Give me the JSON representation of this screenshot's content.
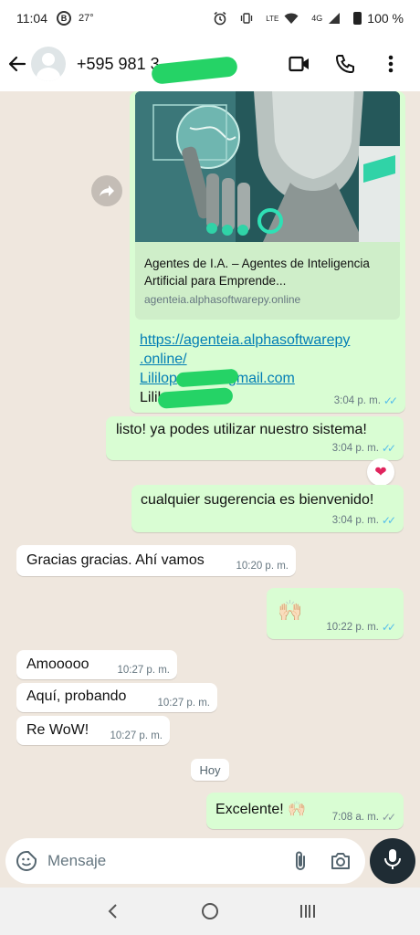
{
  "status_bar": {
    "time": "11:04",
    "temperature": "27°",
    "network": "4G",
    "lte": "LTE",
    "battery": "100 %"
  },
  "header": {
    "contact_name": "+595 981 3",
    "icons": [
      "arrow-left-icon",
      "video-call-icon",
      "phone-icon",
      "more-vert-icon"
    ]
  },
  "messages": [
    {
      "type": "link-preview",
      "preview_title": "Agentes de I.A. – Agentes de Inteligencia Artificial para Emprende...",
      "preview_domain": "agenteia.alphasoftwarepy.online",
      "link_line1": "https://agenteia.alphasoftwarepy",
      "link_line2": ".online/",
      "email": "Lililop",
      "email_suffix": "gmail.com",
      "name_line": "Lililop",
      "time": "3:04 p. m."
    },
    {
      "dir": "out",
      "text": "listo! ya podes utilizar nuestro sistema!",
      "time": "3:04 p. m."
    },
    {
      "dir": "out",
      "text": "cualquier sugerencia es bienvenido!",
      "time": "3:04 p. m."
    },
    {
      "dir": "in",
      "text": "Gracias gracias. Ahí vamos",
      "time": "10:20 p. m."
    },
    {
      "dir": "out",
      "text": "🙌🏻",
      "time": "10:22 p. m."
    },
    {
      "dir": "in",
      "text": "Amooooo",
      "time": "10:27 p. m."
    },
    {
      "dir": "in",
      "text": "Aquí, probando",
      "time": "10:27 p. m."
    },
    {
      "dir": "in",
      "text": "Re WoW!",
      "time": "10:27 p. m."
    },
    {
      "dir": "out",
      "text": "Excelente! 🙌🏻",
      "time": "7:08 a. m."
    }
  ],
  "day_chip": "Hoy",
  "reaction": "❤",
  "composer": {
    "placeholder": "Mensaje"
  }
}
